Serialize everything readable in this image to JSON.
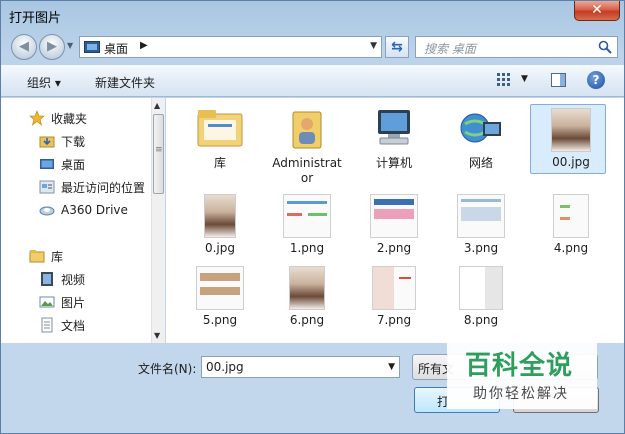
{
  "window": {
    "title": "打开图片",
    "close_glyph": "✕"
  },
  "nav": {
    "back_glyph": "◀",
    "forward_glyph": "▶",
    "address_path": "桌面",
    "address_separator": "▶",
    "refresh_glyph": "⇆",
    "search_placeholder": "搜索 桌面"
  },
  "toolbar": {
    "organize_label": "组织 ▾",
    "new_folder_label": "新建文件夹",
    "help_glyph": "?"
  },
  "sidebar": {
    "items": [
      {
        "label": "收藏夹",
        "icon": "star-icon"
      },
      {
        "label": "下载",
        "icon": "download-folder-icon"
      },
      {
        "label": "桌面",
        "icon": "desktop-icon"
      },
      {
        "label": "最近访问的位置",
        "icon": "recent-places-icon"
      },
      {
        "label": "A360 Drive",
        "icon": "cloud-drive-icon"
      },
      {
        "label": "库",
        "icon": "library-icon"
      },
      {
        "label": "视频",
        "icon": "video-icon"
      },
      {
        "label": "图片",
        "icon": "pictures-icon"
      },
      {
        "label": "文档",
        "icon": "documents-icon"
      }
    ]
  },
  "files": {
    "items": [
      {
        "label": "库",
        "type": "library"
      },
      {
        "label": "Administrator",
        "type": "user-folder"
      },
      {
        "label": "计算机",
        "type": "computer"
      },
      {
        "label": "网络",
        "type": "network"
      },
      {
        "label": "00.jpg",
        "type": "photo",
        "selected": true
      },
      {
        "label": "0.jpg",
        "type": "photo"
      },
      {
        "label": "1.png",
        "type": "png"
      },
      {
        "label": "2.png",
        "type": "png"
      },
      {
        "label": "3.png",
        "type": "png"
      },
      {
        "label": "4.png",
        "type": "png"
      },
      {
        "label": "5.png",
        "type": "png"
      },
      {
        "label": "6.png",
        "type": "photo"
      },
      {
        "label": "7.png",
        "type": "png"
      },
      {
        "label": "8.png",
        "type": "png"
      }
    ]
  },
  "bottom": {
    "filename_label": "文件名(N):",
    "filename_value": "00.jpg",
    "filetype_value": "所有文",
    "open_label": "打"
  },
  "watermark": {
    "title": "百科全说",
    "subtitle": "助你轻松解决"
  },
  "colors": {
    "accent": "#2e9e5c",
    "selection": "#d9ecfc",
    "titlebar": "#bcd3ea"
  }
}
